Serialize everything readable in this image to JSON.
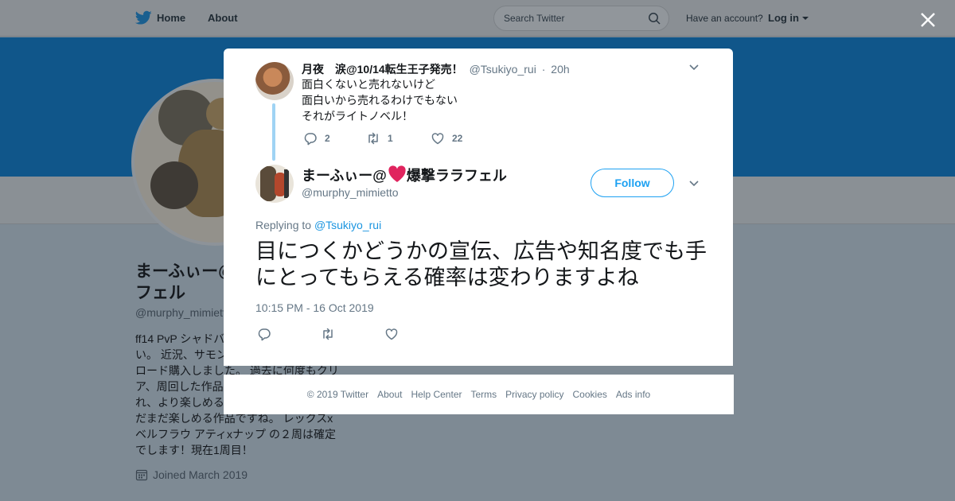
{
  "nav": {
    "home_label": "Home",
    "about_label": "About",
    "search_placeholder": "Search Twitter",
    "have_account": "Have an account?",
    "login_label": "Log in"
  },
  "profile": {
    "name": "まーふぃー@❤️爆撃ララフェル",
    "name_visible": "まーふぃー@\nフェル",
    "handle": "@murphy_mimietto",
    "bio": "ff14 PvP シャドバ\nい。 近況、サモン\nロード購入しました。 過去に何度もクリ\nア、周回した作品\nれ、より楽しめる\nだまだ楽しめる作品ですね。 レックスx\nベルフラウ アティxナップ の２周は確定\nでします！現在1周目！",
    "joined": "Joined March 2019"
  },
  "context_tweet": {
    "name": "月夜　涙@10/14転生王子発売！",
    "handle": "@Tsukiyo_rui",
    "separator": "·",
    "time": "20h",
    "lines": [
      "面白くないと売れないけど",
      "面白いから売れるわけでもない",
      "それがライトノベル！"
    ],
    "replies": "2",
    "retweets": "1",
    "likes": "22"
  },
  "main_tweet": {
    "name_prefix": "まーふぃー@",
    "name_suffix": "爆撃ララフェル",
    "handle": "@murphy_mimietto",
    "follow_label": "Follow",
    "replying_to_label": "Replying to",
    "replying_to_handle": "@Tsukiyo_rui",
    "text": "目につくかどうかの宣伝、広告や知名度でも手にとってもらえる確率は変わりますよね",
    "timestamp": "10:15 PM - 16 Oct 2019"
  },
  "footer": {
    "links": [
      "© 2019 Twitter",
      "About",
      "Help Center",
      "Terms",
      "Privacy policy",
      "Cookies",
      "Ads info"
    ]
  },
  "colors": {
    "accent": "#1da1f2",
    "link": "#1b95e0",
    "muted": "#657786",
    "heart": "#e0245e",
    "thread": "#9fd3f4",
    "banner": "#10568a"
  }
}
